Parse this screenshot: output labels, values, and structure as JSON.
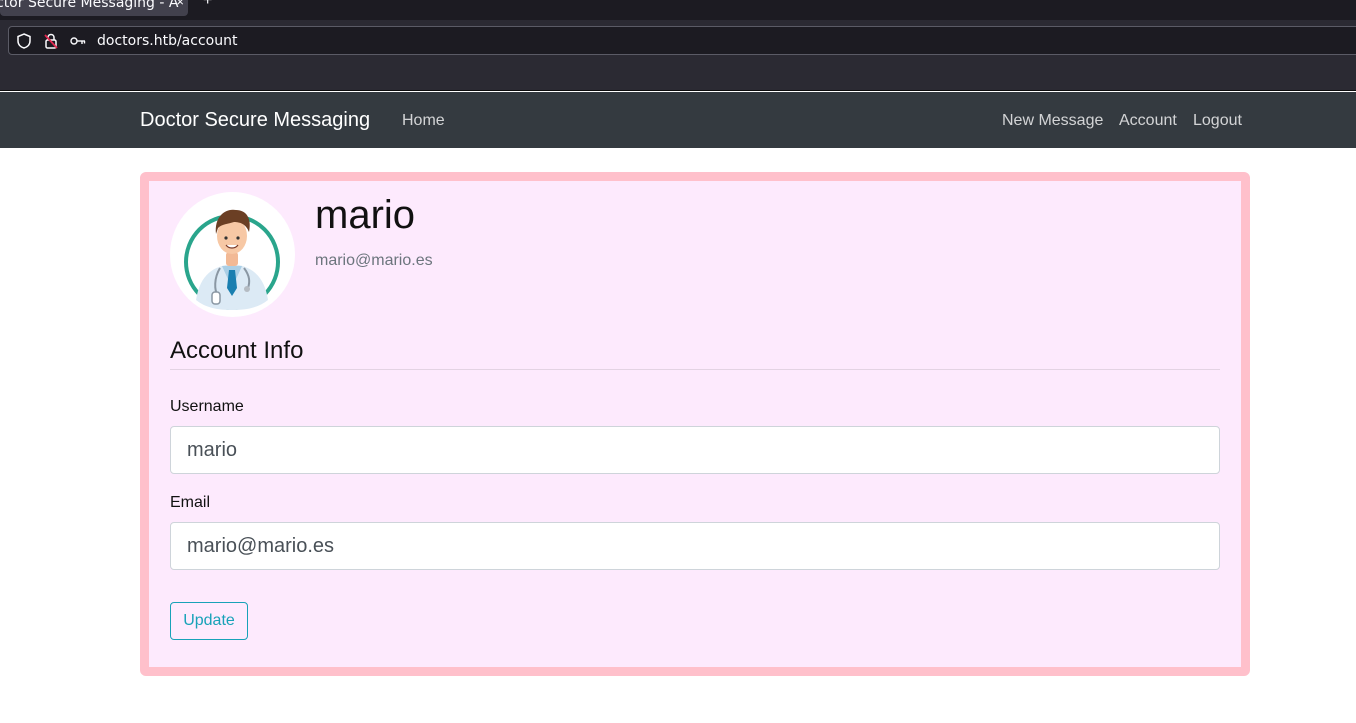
{
  "browser": {
    "tab_title": "ctor Secure Messaging - A",
    "tab_close": "×",
    "new_tab": "+",
    "url": "doctors.htb/account"
  },
  "navbar": {
    "brand": "Doctor Secure Messaging",
    "home": "Home",
    "new_message": "New Message",
    "account": "Account",
    "logout": "Logout"
  },
  "profile": {
    "username": "mario",
    "email": "mario@mario.es"
  },
  "form": {
    "section_title": "Account Info",
    "username_label": "Username",
    "username_value": "mario",
    "email_label": "Email",
    "email_value": "mario@mario.es",
    "update_label": "Update"
  },
  "colors": {
    "navbar_bg": "#343a40",
    "card_bg": "#fdeafd",
    "card_border": "#ffc0cb",
    "accent": "#17a2b8"
  }
}
